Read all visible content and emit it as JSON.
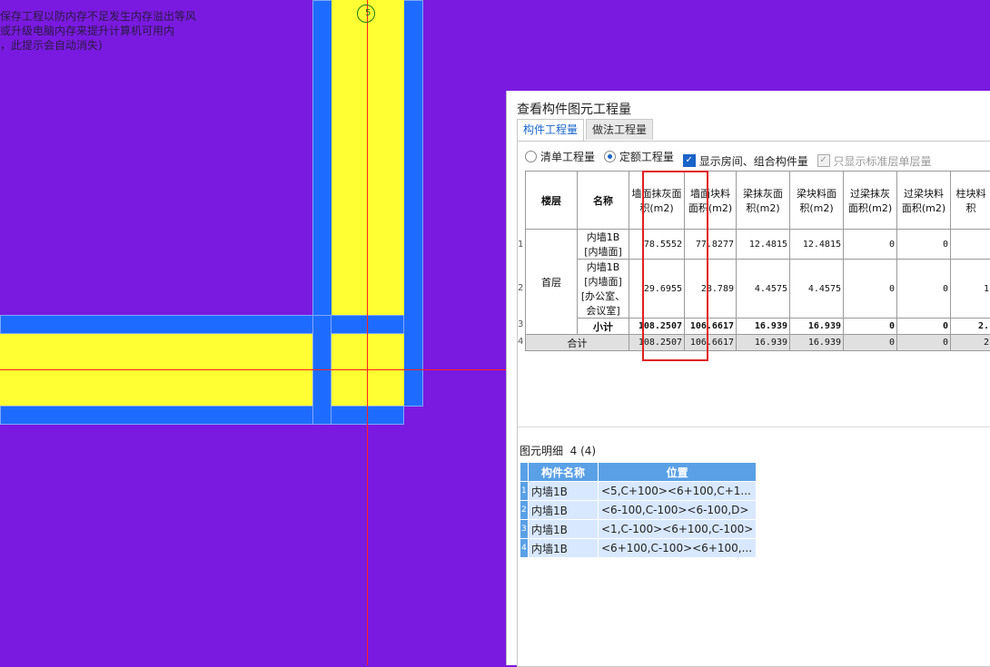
{
  "warning_lines": [
    "保存工程以防内存不足发生内存溢出等风",
    "或升级电脑内存来提升计算机可用内",
    "，此提示会自动消失)"
  ],
  "axis_marker": "5",
  "panel": {
    "title": "查看构件图元工程量",
    "tabs": [
      "构件工程量",
      "做法工程量"
    ],
    "options": {
      "radio1": "清单工程量",
      "radio2": "定额工程量",
      "check1": "显示房间、组合构件量",
      "check2": "只显示标准层单层量"
    },
    "table": {
      "headers": [
        "楼层",
        "名称",
        "墙面抹灰面积(m2)",
        "墙面块料面积(m2)",
        "梁抹灰面积(m2)",
        "梁块料面积(m2)",
        "过梁抹灰面积(m2)",
        "过梁块料面积(m2)",
        "柱块料积"
      ],
      "floor": "首层",
      "row_numbers": [
        "1",
        "2",
        "3",
        "4"
      ],
      "rows": [
        {
          "name": "内墙1B [内墙面]",
          "v": [
            "78.5552",
            "77.8277",
            "12.4815",
            "12.4815",
            "0",
            "0",
            ""
          ]
        },
        {
          "name": "内墙1B [内墙面][办公室、会议室]",
          "v": [
            "29.6955",
            "28.789",
            "4.4575",
            "4.4575",
            "0",
            "0",
            "1"
          ]
        }
      ],
      "subtotal": {
        "name": "小计",
        "v": [
          "108.2507",
          "106.6617",
          "16.939",
          "16.939",
          "0",
          "0",
          "2."
        ]
      },
      "total": {
        "name": "合计",
        "v": [
          "108.2507",
          "106.6617",
          "16.939",
          "16.939",
          "0",
          "0",
          "2"
        ]
      }
    },
    "detail": {
      "label": "图元明细",
      "count": "4 (4)",
      "headers": [
        "构件名称",
        "位置"
      ],
      "rows": [
        {
          "idx": "1",
          "name": "内墙1B",
          "pos": "<5,C+100><6+100,C+1..."
        },
        {
          "idx": "2",
          "name": "内墙1B",
          "pos": "<6-100,C-100><6-100,D>"
        },
        {
          "idx": "3",
          "name": "内墙1B",
          "pos": "<1,C-100><6+100,C-100>"
        },
        {
          "idx": "4",
          "name": "内墙1B",
          "pos": "<6+100,C-100><6+100,..."
        }
      ]
    }
  }
}
